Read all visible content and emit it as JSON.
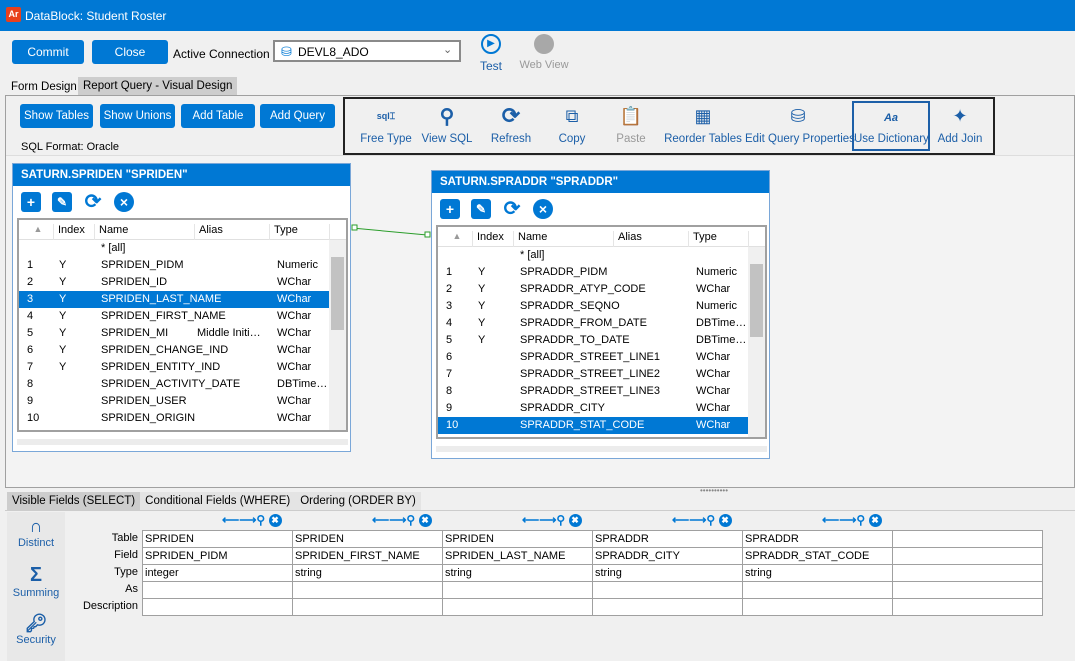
{
  "window": {
    "title": "DataBlock: Student Roster",
    "logo": "Ar"
  },
  "toolbar": {
    "commit": "Commit",
    "close": "Close",
    "active_connection_label": "Active Connection",
    "connection_value": "DEVL8_ADO",
    "test": "Test",
    "web_view": "Web View"
  },
  "tabs": {
    "form_design": "Form Design",
    "report_query": "Report Query - Visual Design"
  },
  "query_buttons": {
    "show_tables": "Show Tables",
    "show_unions": "Show Unions",
    "add_table": "Add Table",
    "add_query": "Add Query",
    "sql_format": "SQL Format: Oracle"
  },
  "ribbon": {
    "free_type": "Free Type",
    "view_sql": "View SQL",
    "refresh": "Refresh",
    "copy": "Copy",
    "paste": "Paste",
    "reorder_tables": "Reorder Tables",
    "edit_query_properties": "Edit Query Properties",
    "use_dictionary": "Use Dictionary",
    "add_join": "Add Join"
  },
  "grid_headers": {
    "index": "Index",
    "name": "Name",
    "alias": "Alias",
    "type": "Type"
  },
  "tables": [
    {
      "title": "SATURN.SPRIDEN \"SPRIDEN\"",
      "selected_row": 3,
      "rows": [
        {
          "num": "",
          "index": "",
          "name": "* [all]",
          "alias": "",
          "type": ""
        },
        {
          "num": "1",
          "index": "Y",
          "name": "SPRIDEN_PIDM",
          "alias": "",
          "type": "Numeric"
        },
        {
          "num": "2",
          "index": "Y",
          "name": "SPRIDEN_ID",
          "alias": "",
          "type": "WChar"
        },
        {
          "num": "3",
          "index": "Y",
          "name": "SPRIDEN_LAST_NAME",
          "alias": "",
          "type": "WChar"
        },
        {
          "num": "4",
          "index": "Y",
          "name": "SPRIDEN_FIRST_NAME",
          "alias": "",
          "type": "WChar"
        },
        {
          "num": "5",
          "index": "Y",
          "name": "SPRIDEN_MI",
          "alias": "Middle Initi…",
          "type": "WChar"
        },
        {
          "num": "6",
          "index": "Y",
          "name": "SPRIDEN_CHANGE_IND",
          "alias": "",
          "type": "WChar"
        },
        {
          "num": "7",
          "index": "Y",
          "name": "SPRIDEN_ENTITY_IND",
          "alias": "",
          "type": "WChar"
        },
        {
          "num": "8",
          "index": "",
          "name": "SPRIDEN_ACTIVITY_DATE",
          "alias": "",
          "type": "DBTime…"
        },
        {
          "num": "9",
          "index": "",
          "name": "SPRIDEN_USER",
          "alias": "",
          "type": "WChar"
        },
        {
          "num": "10",
          "index": "",
          "name": "SPRIDEN_ORIGIN",
          "alias": "",
          "type": "WChar"
        }
      ]
    },
    {
      "title": "SATURN.SPRADDR \"SPRADDR\"",
      "selected_row": 10,
      "rows": [
        {
          "num": "",
          "index": "",
          "name": "* [all]",
          "alias": "",
          "type": ""
        },
        {
          "num": "1",
          "index": "Y",
          "name": "SPRADDR_PIDM",
          "alias": "",
          "type": "Numeric"
        },
        {
          "num": "2",
          "index": "Y",
          "name": "SPRADDR_ATYP_CODE",
          "alias": "",
          "type": "WChar"
        },
        {
          "num": "3",
          "index": "Y",
          "name": "SPRADDR_SEQNO",
          "alias": "",
          "type": "Numeric"
        },
        {
          "num": "4",
          "index": "Y",
          "name": "SPRADDR_FROM_DATE",
          "alias": "",
          "type": "DBTime…"
        },
        {
          "num": "5",
          "index": "Y",
          "name": "SPRADDR_TO_DATE",
          "alias": "",
          "type": "DBTime…"
        },
        {
          "num": "6",
          "index": "",
          "name": "SPRADDR_STREET_LINE1",
          "alias": "",
          "type": "WChar"
        },
        {
          "num": "7",
          "index": "",
          "name": "SPRADDR_STREET_LINE2",
          "alias": "",
          "type": "WChar"
        },
        {
          "num": "8",
          "index": "",
          "name": "SPRADDR_STREET_LINE3",
          "alias": "",
          "type": "WChar"
        },
        {
          "num": "9",
          "index": "",
          "name": "SPRADDR_CITY",
          "alias": "",
          "type": "WChar"
        },
        {
          "num": "10",
          "index": "",
          "name": "SPRADDR_STAT_CODE",
          "alias": "",
          "type": "WChar"
        }
      ]
    }
  ],
  "bottom_tabs": {
    "select": "Visible Fields (SELECT)",
    "where": "Conditional Fields (WHERE)",
    "order": "Ordering (ORDER BY)"
  },
  "side": {
    "distinct": "Distinct",
    "summing": "Summing",
    "security": "Security"
  },
  "field_rows": {
    "table": "Table",
    "field": "Field",
    "type": "Type",
    "as": "As",
    "description": "Description"
  },
  "fields": [
    {
      "table": "SPRIDEN",
      "field": "SPRIDEN_PIDM",
      "type": "integer",
      "as": "",
      "description": ""
    },
    {
      "table": "SPRIDEN",
      "field": "SPRIDEN_FIRST_NAME",
      "type": "string",
      "as": "",
      "description": ""
    },
    {
      "table": "SPRIDEN",
      "field": "SPRIDEN_LAST_NAME",
      "type": "string",
      "as": "",
      "description": ""
    },
    {
      "table": "SPRADDR",
      "field": "SPRADDR_CITY",
      "type": "string",
      "as": "",
      "description": ""
    },
    {
      "table": "SPRADDR",
      "field": "SPRADDR_STAT_CODE",
      "type": "string",
      "as": "",
      "description": ""
    },
    {
      "table": "",
      "field": "",
      "type": "",
      "as": "",
      "description": ""
    }
  ],
  "colors": {
    "accent": "#0078d4",
    "join_line": "#2a9d2a"
  }
}
